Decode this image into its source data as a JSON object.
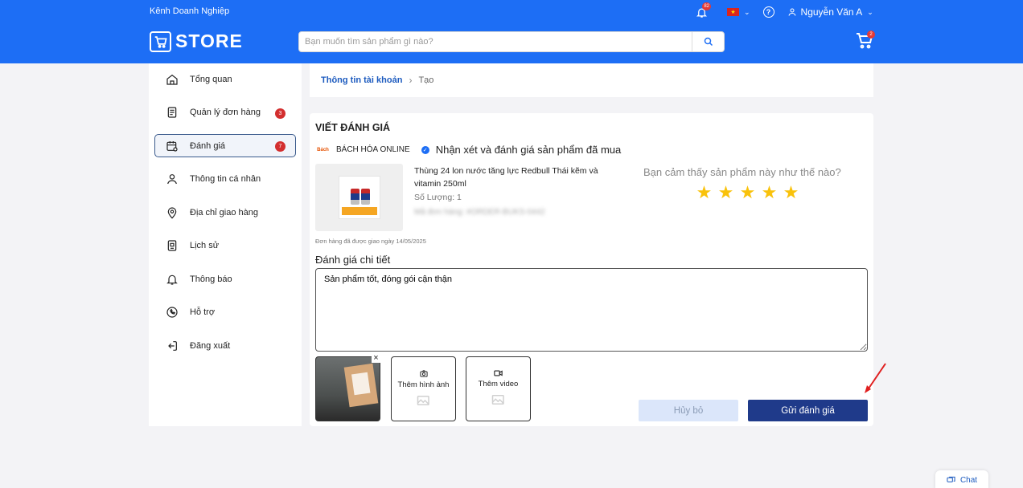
{
  "header": {
    "biz_link": "Kênh Doanh Nghiệp",
    "notification_count": "82",
    "user_name": "Nguyễn Văn A",
    "logo_text": "STORE",
    "search_placeholder": "Bạn muốn tìm sản phẩm gì nào?",
    "cart_count": "2"
  },
  "sidebar": {
    "items": [
      {
        "label": "Tổng quan",
        "icon": "home-icon"
      },
      {
        "label": "Quản lý đơn hàng",
        "icon": "receipt-icon",
        "count": "3"
      },
      {
        "label": "Đánh giá",
        "icon": "calendar-review-icon",
        "count": "7"
      },
      {
        "label": "Thông tin cá nhân",
        "icon": "user-icon"
      },
      {
        "label": "Địa chỉ giao hàng",
        "icon": "location-pin-icon"
      },
      {
        "label": "Lịch sử",
        "icon": "history-icon"
      },
      {
        "label": "Thông báo",
        "icon": "bell-icon"
      },
      {
        "label": "Hỗ trợ",
        "icon": "phone-support-icon"
      },
      {
        "label": "Đăng xuất",
        "icon": "logout-icon"
      }
    ]
  },
  "breadcrumb": {
    "parent": "Thông tin tài khoản",
    "current": "Tạo"
  },
  "review": {
    "title": "VIẾT ĐÁNH GIÁ",
    "shop_logo": "Bách",
    "shop_name": "BÁCH HÓA ONLINE",
    "heading": "Nhận xét và đánh giá sản phẩm đã mua",
    "product_name": "Thùng 24 lon nước tăng lực Redbull Thái kẽm và vitamin 250ml",
    "quantity": "Số Lượng: 1",
    "order_code": "Mã đơn hàng: #ORDER-BUKS-0442",
    "delivered": "Đơn hàng đã được giao ngày 14/05/2025",
    "question": "Bạn cảm thấy sản phẩm này như thế nào?",
    "rating": 5,
    "detail_label": "Đánh giá chi tiết",
    "detail_text": "Sản phẩm tốt, đóng gói cận thận",
    "add_image": "Thêm hình ảnh",
    "add_video": "Thêm video",
    "cancel": "Hủy bỏ",
    "submit": "Gửi đánh giá"
  },
  "chat": {
    "label": "Chat"
  },
  "colors": {
    "brand": "#1d6ef5",
    "submit": "#1f3a8a",
    "star": "#f9c20b",
    "badge": "#d32f2f"
  }
}
